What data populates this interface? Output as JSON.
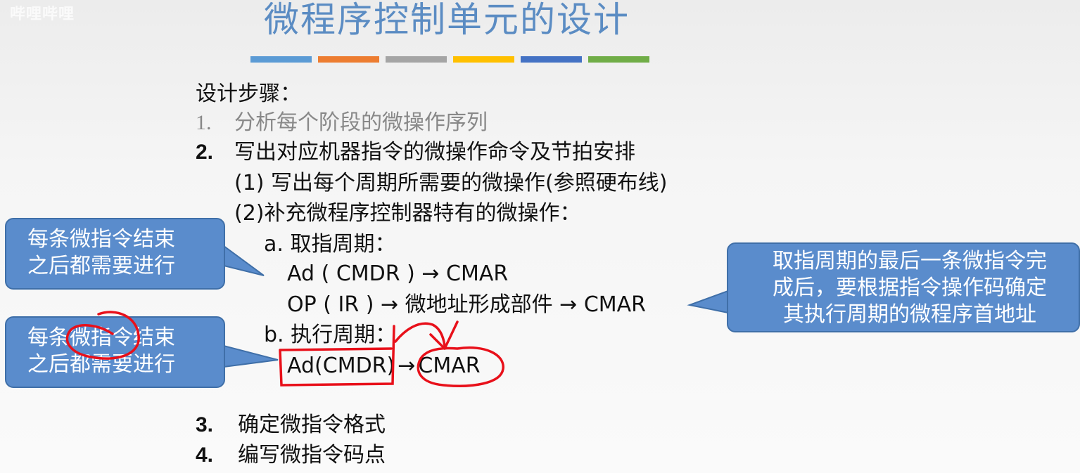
{
  "watermark": "哔哩哔哩",
  "title": "微程序控制单元的设计",
  "color_bars": [
    "#5b9bd5",
    "#ed7d31",
    "#a5a5a5",
    "#ffc000",
    "#4472c4",
    "#70ad47"
  ],
  "steps_heading": "设计步骤：",
  "step1": {
    "num": "1.",
    "text": "分析每个阶段的微操作序列"
  },
  "step2": {
    "num": "2.",
    "text": "写出对应机器指令的微操作命令及节拍安排"
  },
  "sub1": "(1) 写出每个周期所需要的微操作(参照硬布线)",
  "sub2": "(2)补充微程序控制器特有的微操作：",
  "fetch_heading": "a. 取指周期：",
  "fetch_line1": "Ad ( CMDR ) → CMAR",
  "fetch_line2": "OP ( IR ) → 微地址形成部件 → CMAR",
  "exec_heading": "b. 执行周期：",
  "exec_left": "Ad(CMDR)",
  "exec_arrow": "→",
  "exec_right": "CMAR",
  "step3": {
    "num": "3.",
    "text": "确定微指令格式"
  },
  "step4": {
    "num": "4.",
    "text": "编写微指令码点"
  },
  "callout_top": {
    "line1": "每条微指令结束",
    "line2": "之后都需要进行"
  },
  "callout_bottom": {
    "line1": "每条微指令结束",
    "line2": "之后都需要进行"
  },
  "callout_right": {
    "line1": "取指周期的最后一条微指令完",
    "line2": "成后，要根据指令操作码确定",
    "line3": "其执行周期的微程序首地址"
  },
  "annotation_color": "#e8101a"
}
